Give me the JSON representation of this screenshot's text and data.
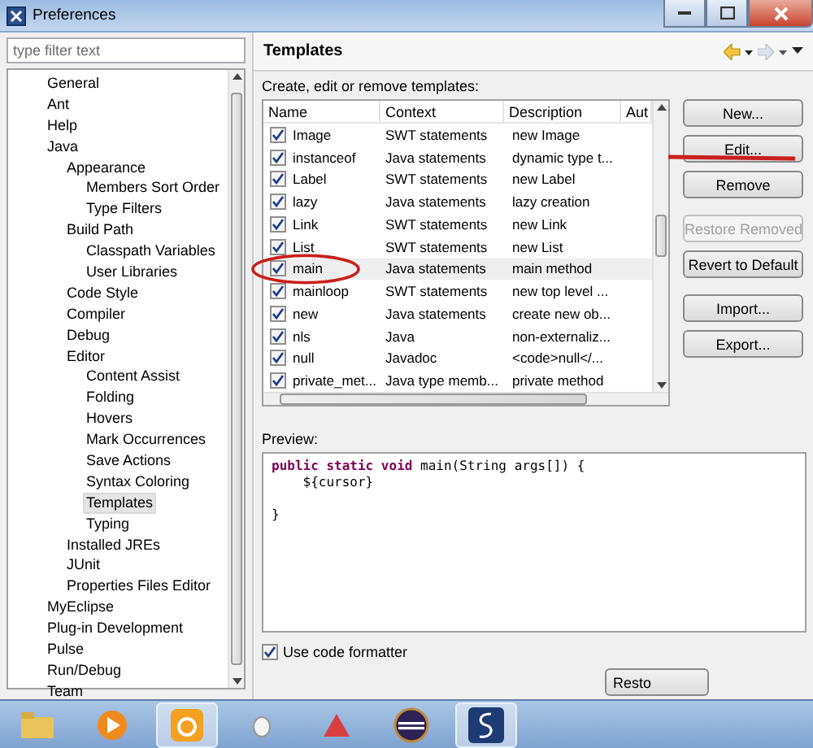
{
  "window": {
    "title": "Preferences"
  },
  "filter": {
    "placeholder": "type filter text"
  },
  "tree": [
    {
      "label": "General",
      "selected": false
    },
    {
      "label": "Ant",
      "selected": false
    },
    {
      "label": "Help",
      "selected": false
    },
    {
      "label": "Java",
      "selected": false,
      "children": [
        {
          "label": "Appearance",
          "selected": false,
          "children": [
            {
              "label": "Members Sort Order",
              "selected": false
            },
            {
              "label": "Type Filters",
              "selected": false
            }
          ]
        },
        {
          "label": "Build Path",
          "selected": false,
          "children": [
            {
              "label": "Classpath Variables",
              "selected": false
            },
            {
              "label": "User Libraries",
              "selected": false
            }
          ]
        },
        {
          "label": "Code Style",
          "selected": false
        },
        {
          "label": "Compiler",
          "selected": false
        },
        {
          "label": "Debug",
          "selected": false
        },
        {
          "label": "Editor",
          "selected": false,
          "children": [
            {
              "label": "Content Assist",
              "selected": false
            },
            {
              "label": "Folding",
              "selected": false
            },
            {
              "label": "Hovers",
              "selected": false
            },
            {
              "label": "Mark Occurrences",
              "selected": false
            },
            {
              "label": "Save Actions",
              "selected": false
            },
            {
              "label": "Syntax Coloring",
              "selected": false
            },
            {
              "label": "Templates",
              "selected": true
            },
            {
              "label": "Typing",
              "selected": false
            }
          ]
        },
        {
          "label": "Installed JREs",
          "selected": false
        },
        {
          "label": "JUnit",
          "selected": false
        },
        {
          "label": "Properties Files Editor",
          "selected": false
        }
      ]
    },
    {
      "label": "MyEclipse",
      "selected": false
    },
    {
      "label": "Plug-in Development",
      "selected": false
    },
    {
      "label": "Pulse",
      "selected": false
    },
    {
      "label": "Run/Debug",
      "selected": false
    },
    {
      "label": "Team",
      "selected": false
    }
  ],
  "page": {
    "title": "Templates",
    "intro": "Create, edit or remove templates:"
  },
  "table": {
    "columns": [
      "Name",
      "Context",
      "Description",
      "Aut"
    ],
    "rows": [
      {
        "checked": true,
        "selected": false,
        "name": "Image",
        "context": "SWT statements",
        "description": "new Image"
      },
      {
        "checked": true,
        "selected": false,
        "name": "instanceof",
        "context": "Java statements",
        "description": "dynamic type t..."
      },
      {
        "checked": true,
        "selected": false,
        "name": "Label",
        "context": "SWT statements",
        "description": "new Label"
      },
      {
        "checked": true,
        "selected": false,
        "name": "lazy",
        "context": "Java statements",
        "description": "lazy creation"
      },
      {
        "checked": true,
        "selected": false,
        "name": "Link",
        "context": "SWT statements",
        "description": "new Link"
      },
      {
        "checked": true,
        "selected": false,
        "name": "List",
        "context": "SWT statements",
        "description": "new List"
      },
      {
        "checked": true,
        "selected": true,
        "name": "main",
        "context": "Java statements",
        "description": "main method"
      },
      {
        "checked": true,
        "selected": false,
        "name": "mainloop",
        "context": "SWT statements",
        "description": "new top level ..."
      },
      {
        "checked": true,
        "selected": false,
        "name": "new",
        "context": "Java statements",
        "description": "create new ob..."
      },
      {
        "checked": true,
        "selected": false,
        "name": "nls",
        "context": "Java",
        "description": "non-externaliz..."
      },
      {
        "checked": true,
        "selected": false,
        "name": "null",
        "context": "Javadoc",
        "description": "<code>null</..."
      },
      {
        "checked": true,
        "selected": false,
        "name": "private_met...",
        "context": "Java type memb...",
        "description": "private method"
      }
    ]
  },
  "button_groups": [
    [
      {
        "label": "New...",
        "disabled": false
      },
      {
        "label": "Edit...",
        "disabled": false
      },
      {
        "label": "Remove",
        "disabled": false
      }
    ],
    [
      {
        "label": "Restore Removed",
        "disabled": true
      },
      {
        "label": "Revert to Default",
        "disabled": false
      }
    ],
    [
      {
        "label": "Import...",
        "disabled": false
      },
      {
        "label": "Export...",
        "disabled": false
      }
    ]
  ],
  "preview": {
    "label": "Preview:",
    "code": "**public static void** main(String args[]) {\n    ${cursor}\n\n}"
  },
  "formatter": {
    "label": "Use code formatter",
    "checked": true
  },
  "restore_button": {
    "label": "Resto"
  }
}
